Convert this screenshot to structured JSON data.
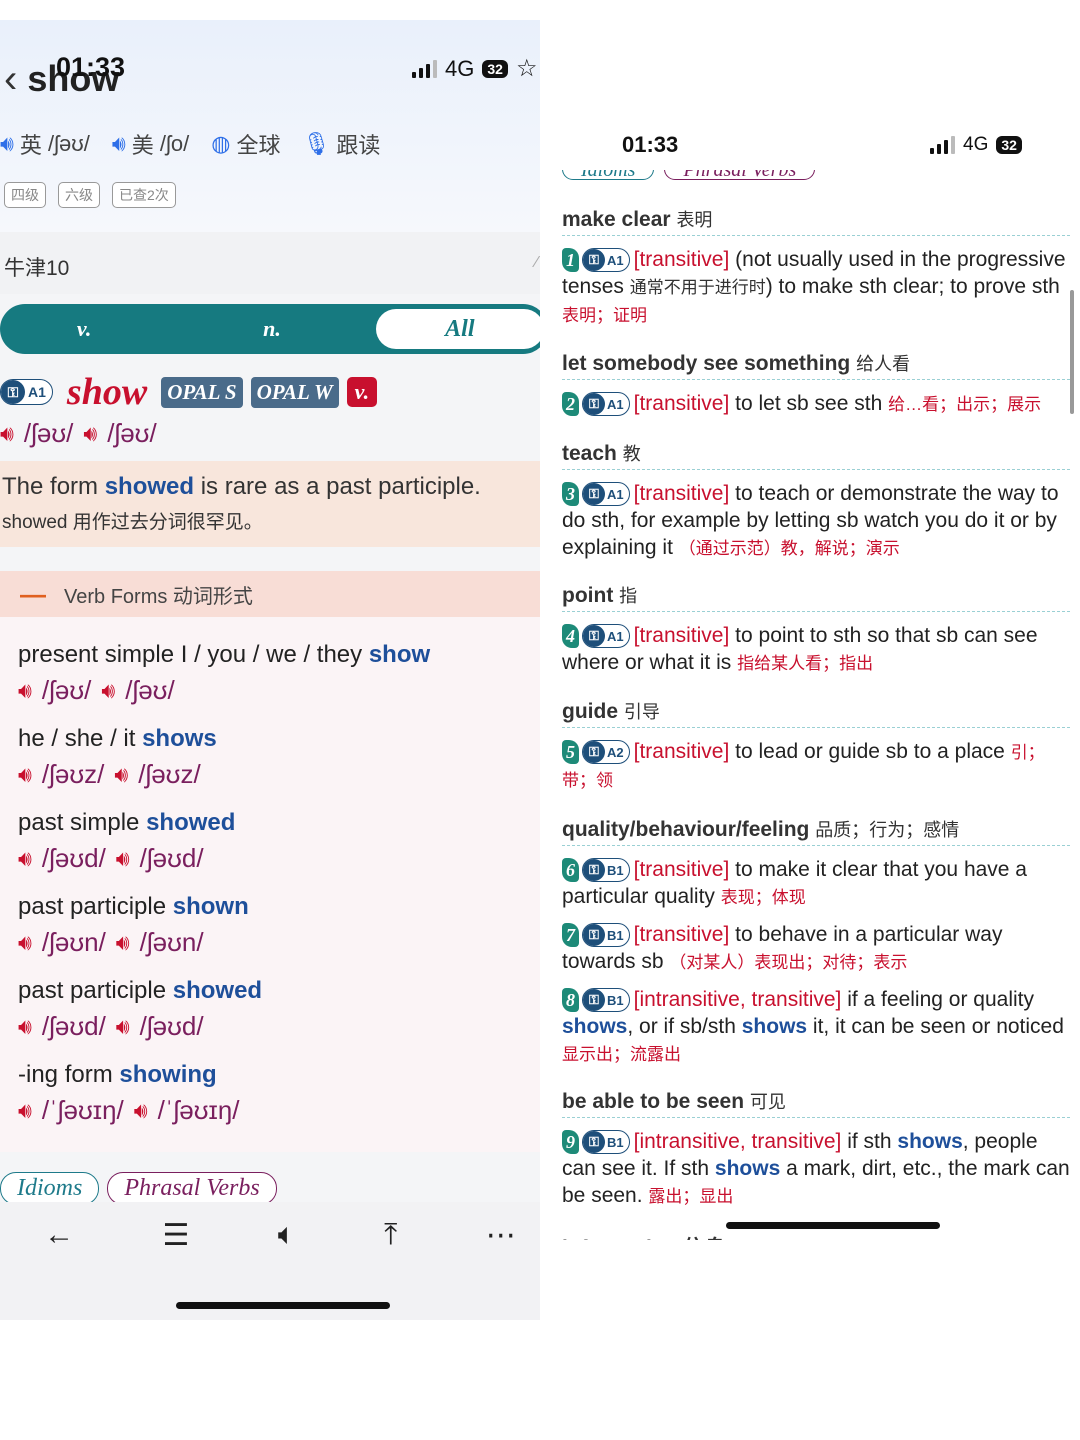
{
  "left": {
    "status": {
      "time": "01:33",
      "network": "4G",
      "battery": "32"
    },
    "header": {
      "title": "show"
    },
    "pron": [
      {
        "region": "英",
        "ipa": "/ʃəʊ/"
      },
      {
        "region": "美",
        "ipa": "/ʃo/"
      }
    ],
    "actions": {
      "global": "全球",
      "follow": "跟读"
    },
    "tags": [
      "四级",
      "六级",
      "已查2次"
    ],
    "dictionary": "牛津10",
    "pos_tabs": [
      "v.",
      "n.",
      "All"
    ],
    "entry": {
      "level": "A1",
      "headword": "show",
      "opal1": "OPAL S",
      "opal2": "OPAL W",
      "pos": "v.",
      "pron_uk": "/ʃəʊ/",
      "pron_us": "/ʃəʊ/"
    },
    "note": {
      "pre": "The form ",
      "word": "showed",
      "post": " is rare as a past participle.",
      "zh": "showed 用作过去分词很罕见。"
    },
    "verb_forms_title": "Verb Forms 动词形式",
    "verb_forms": [
      {
        "label": "present simple I / you / we / they ",
        "word": "show",
        "uk": "/ʃəʊ/",
        "us": "/ʃəʊ/"
      },
      {
        "label": "he / she / it ",
        "word": "shows",
        "uk": "/ʃəʊz/",
        "us": "/ʃəʊz/"
      },
      {
        "label": "past simple ",
        "word": "showed",
        "uk": "/ʃəʊd/",
        "us": "/ʃəʊd/"
      },
      {
        "label": "past participle ",
        "word": "shown",
        "uk": "/ʃəʊn/",
        "us": "/ʃəʊn/"
      },
      {
        "label": "past participle ",
        "word": "showed",
        "uk": "/ʃəʊd/",
        "us": "/ʃəʊd/"
      },
      {
        "label": "-ing form ",
        "word": "showing",
        "uk": "/ˈʃəʊɪŋ/",
        "us": "/ˈʃəʊɪŋ/"
      }
    ],
    "pills": {
      "idioms": "Idioms",
      "phrasal": "Phrasal Verbs"
    }
  },
  "right": {
    "status": {
      "time": "01:33",
      "network": "4G",
      "battery": "32"
    },
    "pills": {
      "idioms": "Idioms",
      "phrasal": "Phrasal Verbs"
    },
    "groups": [
      {
        "head": "make clear",
        "zh": "表明",
        "senses": [
          {
            "num": "1",
            "level": "A1",
            "gram": "[transitive]",
            "text1": " (not usually used in the progressive tenses ",
            "note": "通常不用于进行时",
            "text2": ") to make sth clear; to prove sth ",
            "zh": "表明；证明"
          }
        ]
      },
      {
        "head": "let somebody see something",
        "zh": "给人看",
        "senses": [
          {
            "num": "2",
            "level": "A1",
            "gram": "[transitive]",
            "text1": " to let sb see sth ",
            "zh": "给…看；出示；展示"
          }
        ]
      },
      {
        "head": "teach",
        "zh": "教",
        "senses": [
          {
            "num": "3",
            "level": "A1",
            "gram": "[transitive]",
            "text1": " to teach or demonstrate the way to do sth, for example by letting sb watch you do it or by explaining it ",
            "zh": "（通过示范）教，解说；演示"
          }
        ]
      },
      {
        "head": "point",
        "zh": "指",
        "senses": [
          {
            "num": "4",
            "level": "A1",
            "gram": "[transitive]",
            "text1": " to point to sth so that sb can see where or what it is ",
            "zh": "指给某人看；指出"
          }
        ]
      },
      {
        "head": "guide",
        "zh": "引导",
        "senses": [
          {
            "num": "5",
            "level": "A2",
            "gram": "[transitive]",
            "text1": " to lead or guide sb to a place ",
            "zh": "引；带；领"
          }
        ]
      },
      {
        "head": "quality/behaviour/feeling",
        "zh": "品质；行为；感情",
        "senses": [
          {
            "num": "6",
            "level": "B1",
            "gram": "[transitive]",
            "text1": " to make it clear that you have a particular quality ",
            "zh": "表现；体现"
          },
          {
            "num": "7",
            "level": "B1",
            "gram": "[transitive]",
            "text1": " to behave in a particular way towards sb ",
            "zh": "（对某人）表现出；对待；表示"
          },
          {
            "num": "8",
            "level": "B1",
            "gram": "[intransitive, transitive]",
            "text1": " if a feeling or quality ",
            "hw1": "shows",
            "text2": ", or if sb/sth ",
            "hw2": "shows",
            "text3": " it, it can be seen or noticed ",
            "zh": "显示出；流露出"
          }
        ]
      },
      {
        "head": "be able to be seen",
        "zh": "可见",
        "senses": [
          {
            "num": "9",
            "level": "B1",
            "gram": "[intransitive, transitive]",
            "text1": " if sth ",
            "hw1": "shows",
            "text2": ", people can see it. If sth ",
            "hw2": "shows",
            "text3": " a mark, dirt, etc., the mark can be seen. ",
            "zh": "露出；显出"
          }
        ]
      }
    ],
    "cutoff_head": "information 信息"
  }
}
